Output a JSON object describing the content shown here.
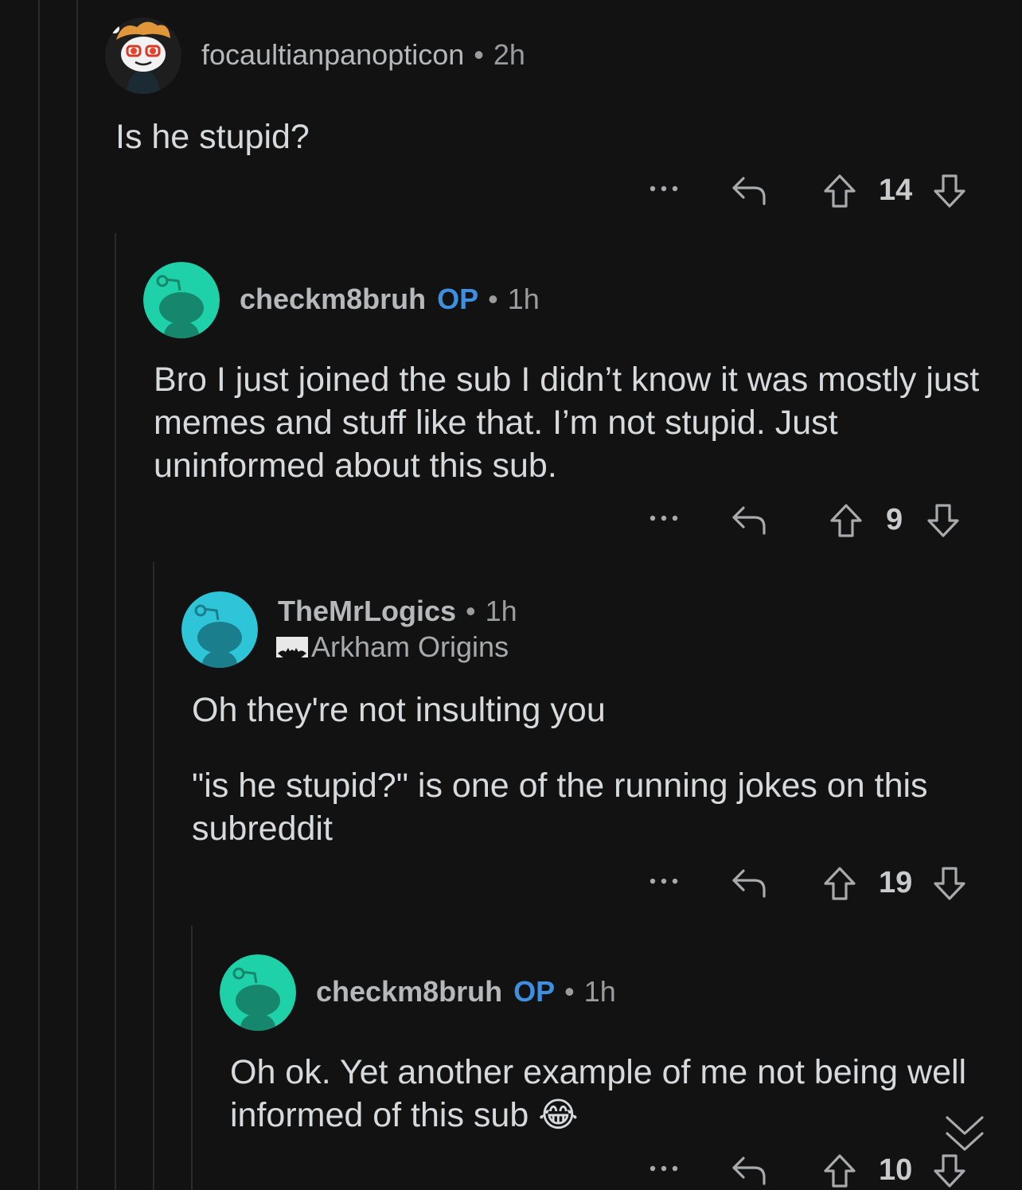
{
  "comments": [
    {
      "username": "focaultianpanopticon",
      "op_label": "",
      "separator": "•",
      "time": "2h",
      "flair": "",
      "body": [
        "Is he stupid?"
      ],
      "score": "14"
    },
    {
      "username": "checkm8bruh",
      "op_label": "OP",
      "separator": "•",
      "time": "1h",
      "flair": "",
      "body": [
        "Bro I just joined the sub I didn’t know it was mostly just memes and stuff like that. I’m not stupid. Just uninformed about this sub."
      ],
      "score": "9"
    },
    {
      "username": "TheMrLogics",
      "op_label": "",
      "separator": "•",
      "time": "1h",
      "flair": "Arkham Origins",
      "body": [
        "Oh they're not insulting you",
        "\"is he stupid?\" is one of the running jokes on this subreddit"
      ],
      "score": "19"
    },
    {
      "username": "checkm8bruh",
      "op_label": "OP",
      "separator": "•",
      "time": "1h",
      "flair": "",
      "body": [
        "Oh ok. Yet another example of me not being well informed of this sub 😂"
      ],
      "score": "10"
    }
  ],
  "icons": {
    "more": "more-options-icon",
    "reply": "reply-icon",
    "upvote": "upvote-arrow-icon",
    "downvote": "downvote-arrow-icon",
    "collapse": "collapse-chevron-icon"
  },
  "colors": {
    "background": "#121212",
    "op": "#3d8fe0",
    "avatar_teal": "#1fd1a8",
    "avatar_cyan": "#2ec5d8"
  }
}
